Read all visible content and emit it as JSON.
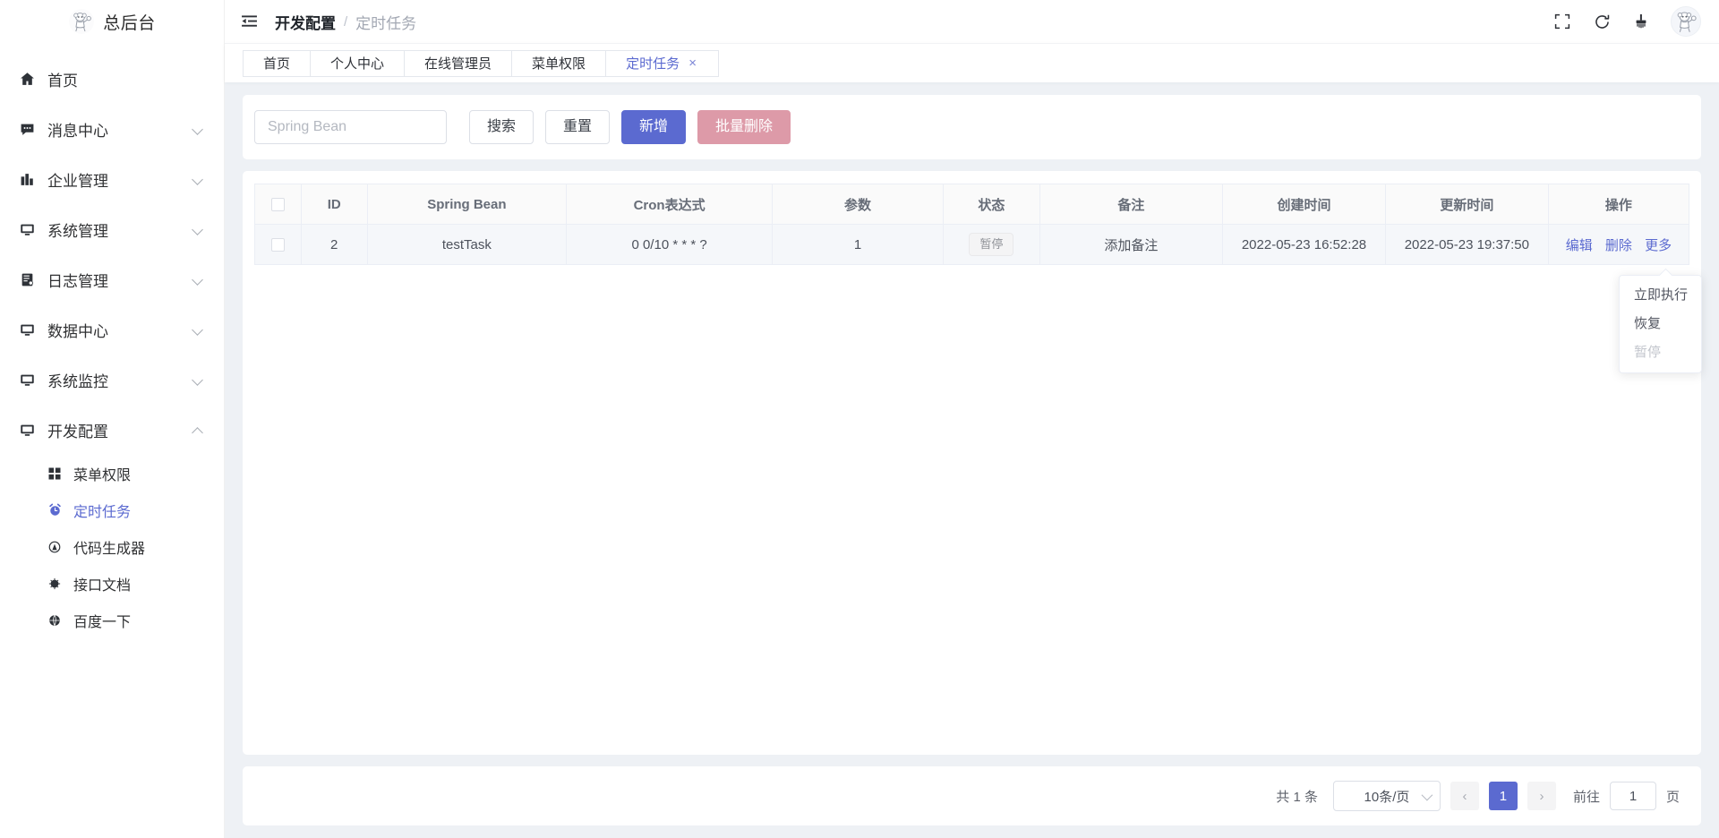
{
  "brand": {
    "title": "总后台",
    "logo_icon": "mascot-logo-icon"
  },
  "sidebar": {
    "items": [
      {
        "label": "首页",
        "icon": "home-icon",
        "expandable": false
      },
      {
        "label": "消息中心",
        "icon": "message-icon",
        "expandable": true
      },
      {
        "label": "企业管理",
        "icon": "building-icon",
        "expandable": true
      },
      {
        "label": "系统管理",
        "icon": "monitor-icon",
        "expandable": true
      },
      {
        "label": "日志管理",
        "icon": "notebook-icon",
        "expandable": true
      },
      {
        "label": "数据中心",
        "icon": "monitor-icon",
        "expandable": true
      },
      {
        "label": "系统监控",
        "icon": "monitor-icon",
        "expandable": true
      },
      {
        "label": "开发配置",
        "icon": "monitor-icon",
        "expandable": true,
        "expanded": true
      }
    ],
    "submenu": [
      {
        "label": "菜单权限",
        "icon": "grid-icon",
        "active": false
      },
      {
        "label": "定时任务",
        "icon": "alarm-clock-icon",
        "active": true
      },
      {
        "label": "代码生成器",
        "icon": "code-gen-icon",
        "active": false
      },
      {
        "label": "接口文档",
        "icon": "api-doc-icon",
        "active": false
      },
      {
        "label": "百度一下",
        "icon": "globe-icon",
        "active": false
      }
    ]
  },
  "topbar": {
    "collapse_icon": "menu-fold-icon",
    "breadcrumb": {
      "parent": "开发配置",
      "separator": "/",
      "current": "定时任务"
    },
    "icons": [
      {
        "name": "fullscreen-icon"
      },
      {
        "name": "refresh-icon"
      },
      {
        "name": "theme-brush-icon"
      }
    ],
    "avatar_icon": "user-avatar-icon"
  },
  "tabs": [
    {
      "label": "首页",
      "active": false,
      "closable": false
    },
    {
      "label": "个人中心",
      "active": false,
      "closable": false
    },
    {
      "label": "在线管理员",
      "active": false,
      "closable": false
    },
    {
      "label": "菜单权限",
      "active": false,
      "closable": false
    },
    {
      "label": "定时任务",
      "active": true,
      "closable": true,
      "close_glyph": "×"
    }
  ],
  "toolbar": {
    "search_placeholder": "Spring Bean",
    "search_value": "",
    "search_label": "搜索",
    "reset_label": "重置",
    "add_label": "新增",
    "batch_delete_label": "批量删除"
  },
  "table": {
    "columns": [
      "",
      "ID",
      "Spring Bean",
      "Cron表达式",
      "参数",
      "状态",
      "备注",
      "创建时间",
      "更新时间",
      "操作"
    ],
    "rows": [
      {
        "id": "2",
        "spring_bean": "testTask",
        "cron": "0 0/10 * * * ?",
        "params": "1",
        "status": "暂停",
        "remark": "添加备注",
        "created_at": "2022-05-23 16:52:28",
        "updated_at": "2022-05-23 19:37:50",
        "actions": [
          "编辑",
          "删除",
          "更多"
        ]
      }
    ]
  },
  "dropdown": {
    "visible": true,
    "items": [
      {
        "label": "立即执行",
        "disabled": false
      },
      {
        "label": "恢复",
        "disabled": false
      },
      {
        "label": "暂停",
        "disabled": true
      }
    ]
  },
  "pagination": {
    "total_text": "共 1 条",
    "page_size_label": "10条/页",
    "prev_glyph": "‹",
    "next_glyph": "›",
    "current_page": "1",
    "jump_label": "前往",
    "jump_value": "1",
    "jump_unit": "页"
  },
  "colors": {
    "primary": "#5b6ad0",
    "danger": "#dd9aa8",
    "page_bg": "#eef1f5",
    "card_bg": "#ffffff",
    "row_bg": "#f5f7fa"
  }
}
